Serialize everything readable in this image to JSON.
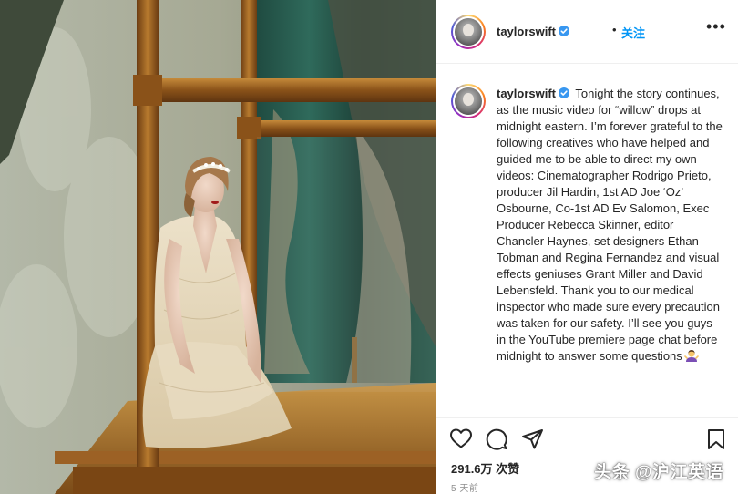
{
  "header": {
    "username": "taylorswift",
    "dot": "•",
    "follow_label": "关注",
    "more_label": "•••"
  },
  "caption": {
    "username": "taylorswift",
    "text": "Tonight the story continues, as the music video for “willow” drops at midnight eastern. I’m forever grateful to the following creatives who have helped and guided me to be able to direct my own videos: Cinematographer Rodrigo Prieto, producer Jil Hardin, 1st AD Joe ‘Oz’ Osbourne, Co-1st AD Ev Salomon, Exec Producer Rebecca Skinner, editor Chancler Haynes, set designers Ethan Tobman and Regina Fernandez and visual effects geniuses Grant Miller and David Lebensfeld. Thank you to our medical inspector who made sure every precaution was taken for our safety. I’ll see you guys in the YouTube premiere page chat before midnight to answer some questions",
    "emoji": "woman-shrugging-emoji"
  },
  "actions": {
    "icons": [
      "heart-icon",
      "comment-icon",
      "share-icon",
      "bookmark-icon"
    ],
    "likes": "291.6万 次赞",
    "time_ago": "5 天前"
  },
  "watermark": "头条 @沪江英语",
  "colors": {
    "accent": "#0095f6",
    "verified": "#3897f0",
    "text": "#262626",
    "muted": "#8e8e8e",
    "border": "#efefef"
  }
}
